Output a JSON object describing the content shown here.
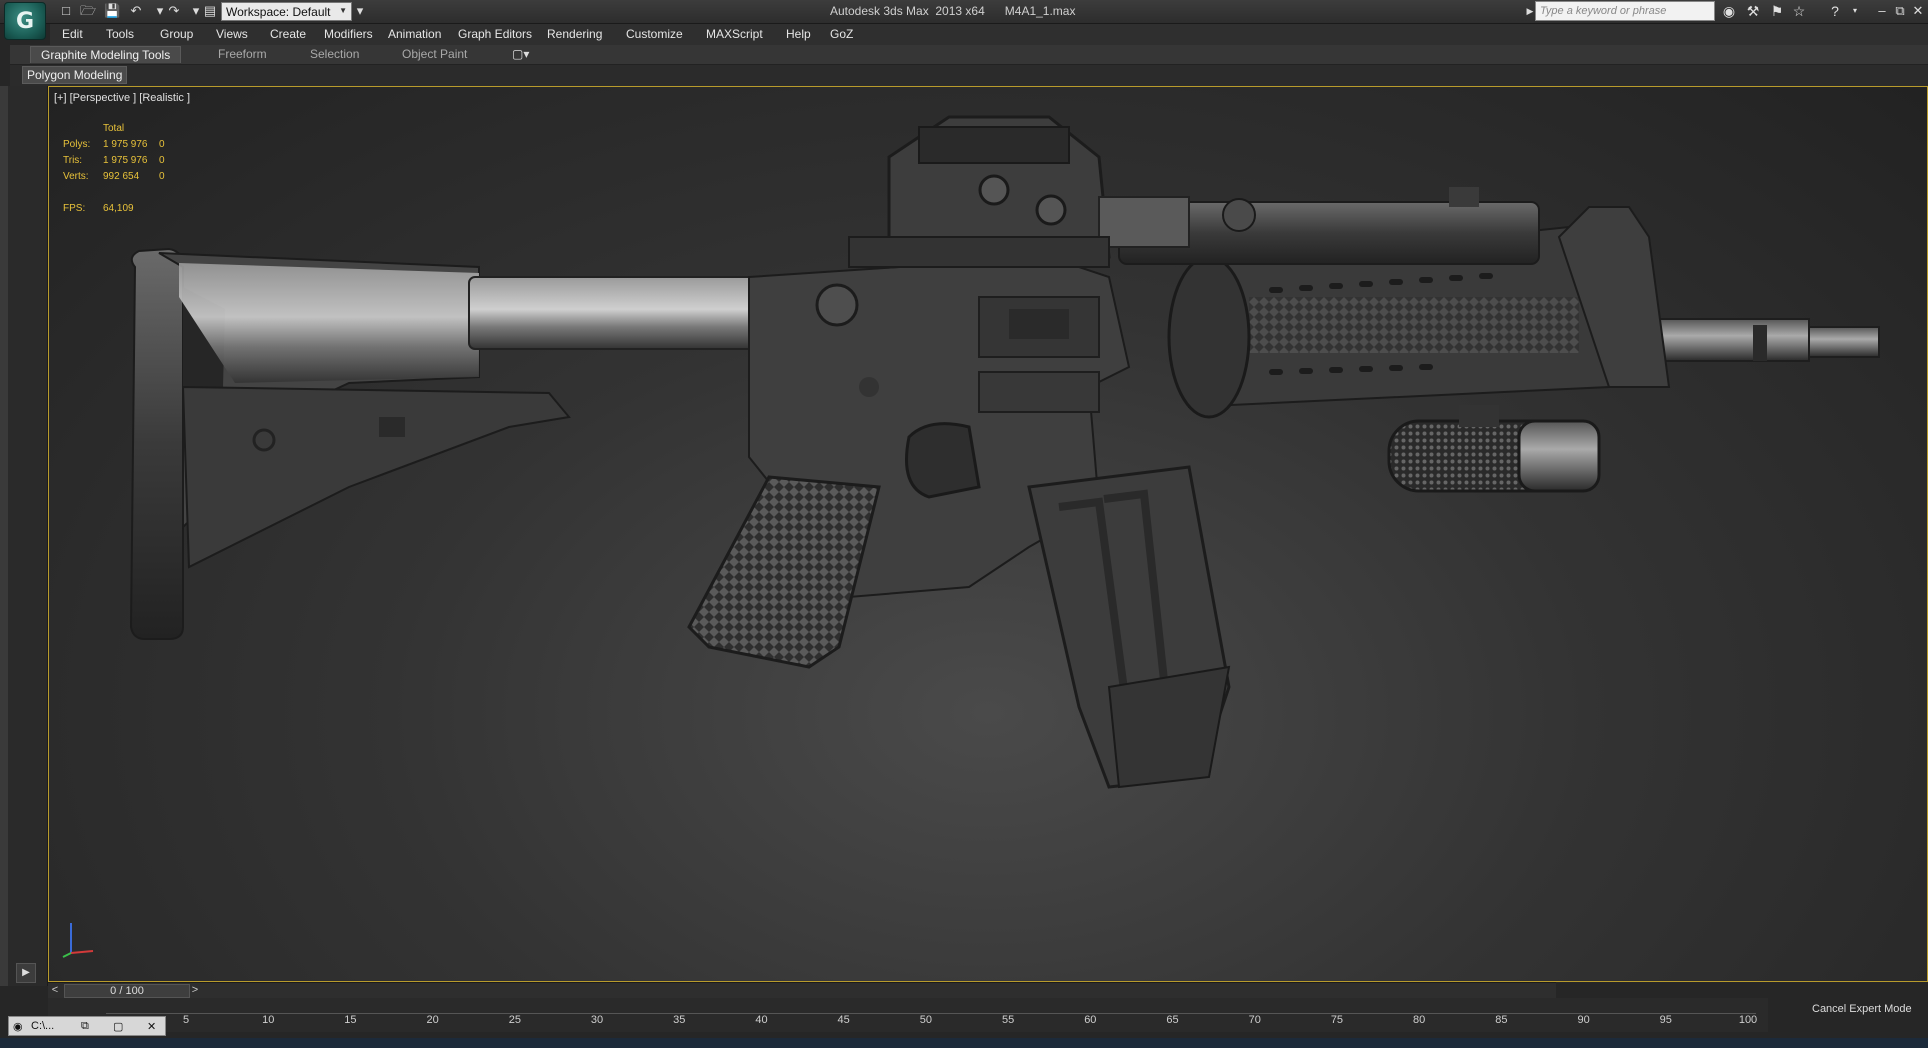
{
  "titlebar": {
    "app_logo": "G",
    "workspace_label": "Workspace: Default",
    "title": "Autodesk 3ds Max  2013 x64      M4A1_1.max",
    "search_placeholder": "Type a keyword or phrase",
    "help_label": "?"
  },
  "menu": [
    "Edit",
    "Tools",
    "Group",
    "Views",
    "Create",
    "Modifiers",
    "Animation",
    "Graph Editors",
    "Rendering",
    "Customize",
    "MAXScript",
    "Help",
    "GoZ"
  ],
  "ribbon": {
    "tabs": [
      "Graphite Modeling Tools",
      "Freeform",
      "Selection",
      "Object Paint"
    ],
    "panel_label": "Polygon Modeling"
  },
  "viewport": {
    "label": "[+] [Perspective ] [Realistic ]",
    "stats": {
      "header": "Total",
      "polys_label": "Polys:",
      "polys_value": "1 975 976",
      "polys_sel": "0",
      "tris_label": "Tris:",
      "tris_value": "1 975 976",
      "tris_sel": "0",
      "verts_label": "Verts:",
      "verts_value": "992 654",
      "verts_sel": "0",
      "fps_label": "FPS:",
      "fps_value": "64,109"
    },
    "border_color": "#b89b2c",
    "stats_color": "#e8c23a"
  },
  "timeline": {
    "slider_text": "0 / 100",
    "prev": "<",
    "next": ">",
    "ticks": [
      "5",
      "10",
      "15",
      "20",
      "25",
      "30",
      "35",
      "40",
      "45",
      "50",
      "55",
      "60",
      "65",
      "70",
      "75",
      "80",
      "85",
      "90",
      "95",
      "100"
    ]
  },
  "status": {
    "cancel_expert_mode": "Cancel Expert Mode",
    "taskbar_label": "C:\\..."
  }
}
